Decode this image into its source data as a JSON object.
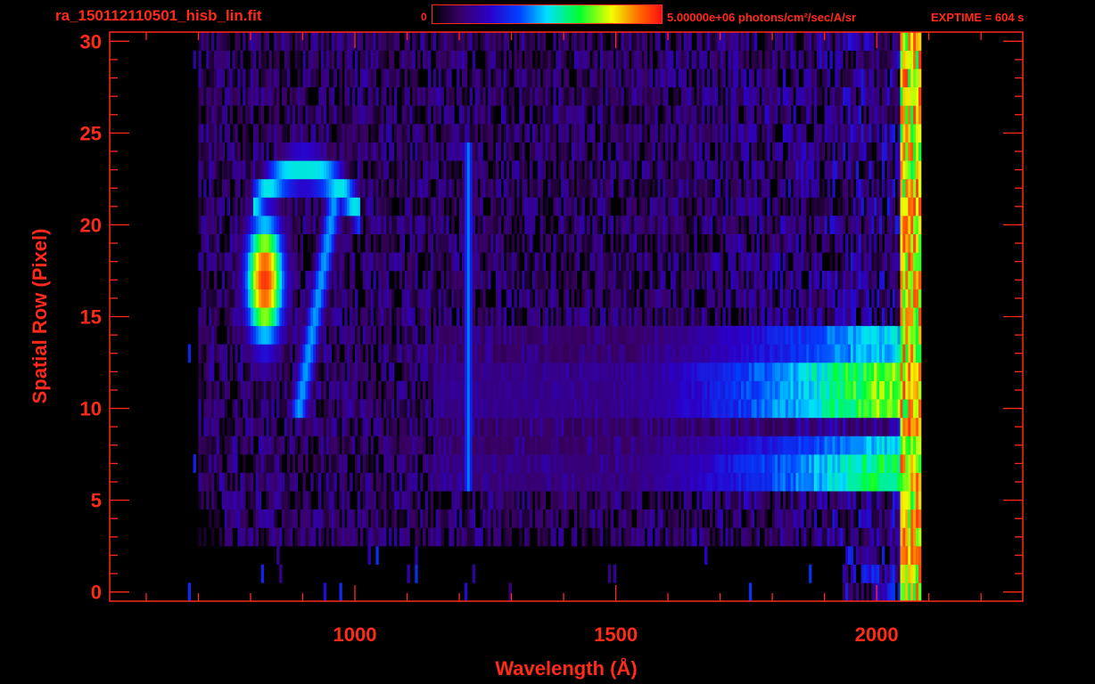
{
  "header": {
    "file_title": "ra_150112110501_hisb_lin.fit",
    "colorbar_min": "0",
    "colorbar_max": "5.00000e+06 photons/cm²/sec/A/sr",
    "exptime": "EXPTIME = 604 s"
  },
  "colors": {
    "axis": "#ff2a1a",
    "background": "#000000",
    "colormap": [
      "#000000",
      "#3a0066",
      "#2b00c8",
      "#0040ff",
      "#00e0ff",
      "#00ff30",
      "#f0ff00",
      "#ff6a00",
      "#ff1010"
    ]
  },
  "chart_data": {
    "type": "heatmap",
    "title": "",
    "xlabel": "Wavelength (Å)",
    "ylabel": "Spatial Row (Pixel)",
    "xlim": [
      530,
      2280
    ],
    "ylim": [
      -0.5,
      30.5
    ],
    "x_ticks": [
      1000,
      1500,
      2000
    ],
    "y_ticks": [
      0,
      5,
      10,
      15,
      20,
      25,
      30
    ],
    "x_tick_labels": [
      "1000",
      "1500",
      "2000"
    ],
    "y_tick_labels": [
      "0",
      "5",
      "10",
      "15",
      "20",
      "25",
      "30"
    ],
    "value_range": [
      0,
      5000000
    ],
    "value_unit": "photons/cm²/sec/A/sr",
    "data_extent_x": [
      700,
      2080
    ],
    "features": [
      {
        "name": "arc emission",
        "x_range": [
          790,
          1020
        ],
        "y_range": [
          10,
          24
        ],
        "peak_x": 800,
        "peak_y": 17,
        "peak_level": 0.95
      },
      {
        "name": "line",
        "x": 1215,
        "y_range": [
          6,
          24
        ],
        "peak_level": 0.42
      },
      {
        "name": "band",
        "x_range": [
          1150,
          2070
        ],
        "y_range": [
          6,
          14
        ],
        "peak_x": 1990,
        "peak_level": 0.72
      }
    ]
  }
}
